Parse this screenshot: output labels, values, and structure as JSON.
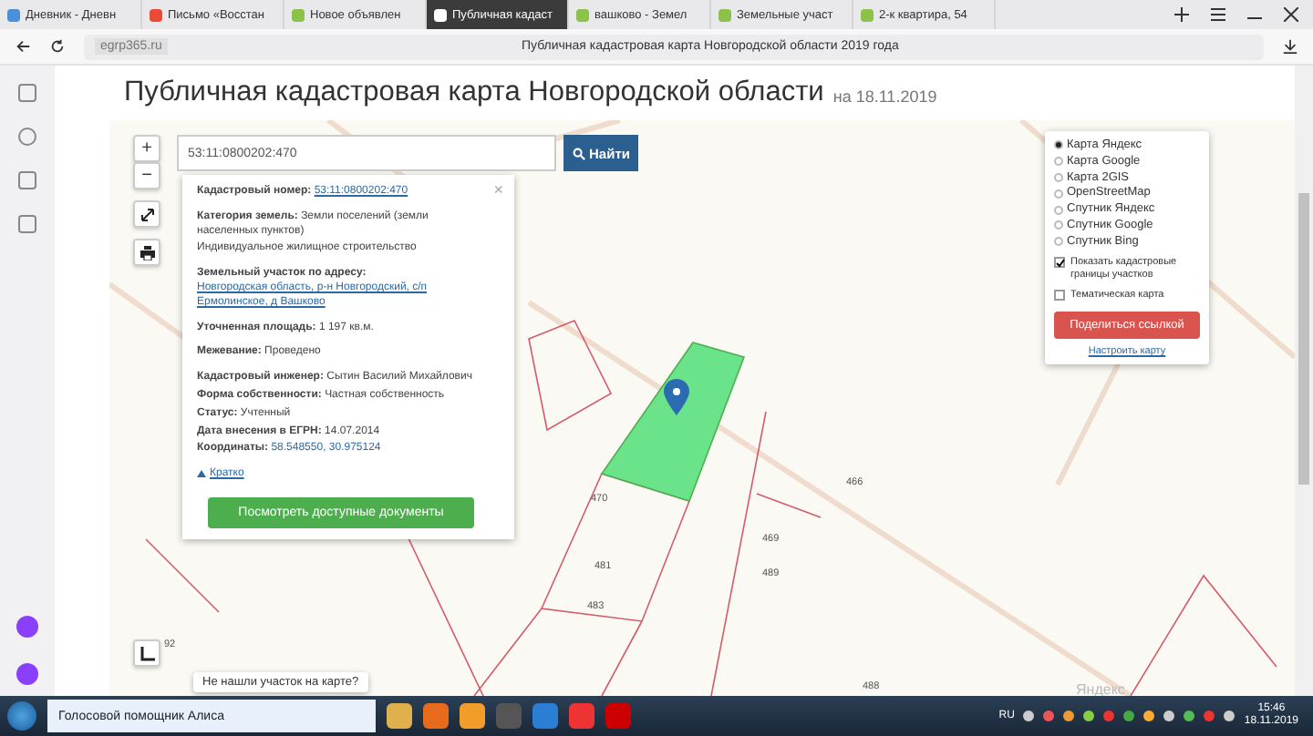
{
  "browser": {
    "tabs": [
      {
        "label": "Дневник - Дневн",
        "selected": false,
        "color": "#4a90d9"
      },
      {
        "label": "Письмо «Восстан",
        "selected": false,
        "color": "#e94b35"
      },
      {
        "label": "Новое объявлен",
        "selected": false,
        "color": "#8bc34a"
      },
      {
        "label": "Публичная кадаст",
        "selected": true,
        "color": "#ffffff"
      },
      {
        "label": "вашково - Земел",
        "selected": false,
        "color": "#8bc34a"
      },
      {
        "label": "Земельные участ",
        "selected": false,
        "color": "#8bc34a"
      },
      {
        "label": "2-к квартира, 54",
        "selected": false,
        "color": "#8bc34a"
      }
    ],
    "url": "egrp365.ru",
    "page_title": "Публичная кадастровая карта Новгородской области 2019 года"
  },
  "page": {
    "title": "Публичная кадастровая карта Новгородской области",
    "date": "на 18.11.2019"
  },
  "search": {
    "value": "53:11:0800202:470",
    "button": "Найти"
  },
  "zoom": {
    "plus": "+",
    "minus": "−"
  },
  "info": {
    "sections": [
      [
        {
          "label": "Кадастровый номер:",
          "value": "53:11:0800202:470",
          "kind": "link"
        }
      ],
      [
        {
          "label": "Категория земель:",
          "value": "Земли поселений (земли населенных пунктов)",
          "kind": "text"
        },
        {
          "value": "Индивидуальное жилищное строительство",
          "kind": "text"
        }
      ],
      [
        {
          "label": "Земельный участок по адресу:",
          "value": "Новгородская область, р-н Новгородский, с/п Ермолинское, д Вашково",
          "kind": "link"
        }
      ],
      [
        {
          "label": "Уточненная площадь:",
          "value": "1 197 кв.м.",
          "kind": "text"
        }
      ],
      [
        {
          "label": "Межевание:",
          "value": "Проведено",
          "kind": "text"
        }
      ],
      [
        {
          "label": "Кадастровый инженер:",
          "value": "Сытин Василий Михайлович",
          "kind": "text"
        },
        {
          "label": "Форма собственности:",
          "value": "Частная собственность",
          "kind": "text"
        },
        {
          "label": "Статус:",
          "value": "Учтенный",
          "kind": "text"
        },
        {
          "label": "Дата внесения в ЕГРН:",
          "value": "14.07.2014",
          "kind": "text"
        },
        {
          "label": "Координаты:",
          "value": "58.548550, 30.975124",
          "kind": "coords"
        }
      ]
    ],
    "collapse": "Кратко",
    "close": "×",
    "button": "Посмотреть доступные документы"
  },
  "layers": {
    "maps": [
      {
        "label": "Карта Яндекс",
        "selected": true
      },
      {
        "label": "Карта Google",
        "selected": false
      },
      {
        "label": "Карта 2GIS",
        "selected": false
      },
      {
        "label": "OpenStreetMap",
        "selected": false
      },
      {
        "label": "Спутник Яндекс",
        "selected": false
      },
      {
        "label": "Спутник Google",
        "selected": false
      },
      {
        "label": "Спутник Bing",
        "selected": false
      }
    ],
    "options": [
      {
        "label": "Показать кадастровые границы участков",
        "checked": true
      },
      {
        "label": "Тематическая карта",
        "checked": false
      }
    ],
    "share": "Поделиться ссылкой",
    "settings": "Настроить карту"
  },
  "map": {
    "parcels": [
      "470",
      "481",
      "483",
      "466",
      "469",
      "489",
      "488",
      "92"
    ],
    "hint": "Не нашли участок на карте?",
    "logo": "Яндекс"
  },
  "taskbar": {
    "search_placeholder": "Голосовой помощник Алиса",
    "language": "RU",
    "time": "15:46",
    "date": "18.11.2019"
  }
}
